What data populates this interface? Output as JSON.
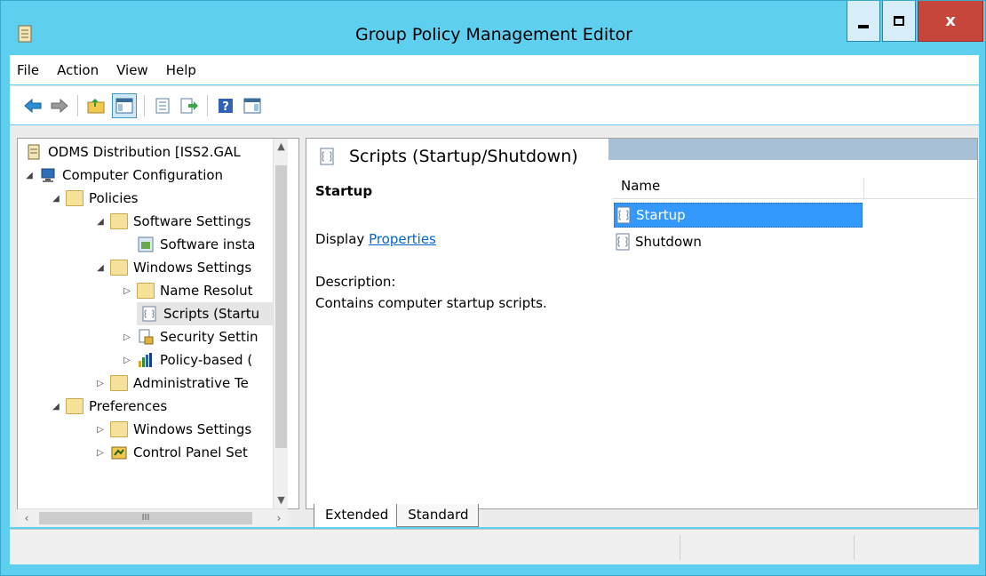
{
  "window": {
    "title": "Group Policy Management Editor",
    "close_label": "x"
  },
  "menu": [
    "File",
    "Action",
    "View",
    "Help"
  ],
  "toolbar": {
    "buttons": [
      "back-icon",
      "forward-icon",
      "up-folder-icon",
      "show-hide-console-tree-icon",
      "properties-icon",
      "export-list-icon",
      "help-icon",
      "show-hide-action-pane-icon"
    ]
  },
  "tree": {
    "items": [
      {
        "label": "ODMS Distribution [ISS2.GAL",
        "level": 0
      },
      {
        "label": "Computer Configuration",
        "level": 1
      },
      {
        "label": "Policies",
        "level": 2
      },
      {
        "label": "Software Settings",
        "level": 3
      },
      {
        "label": "Software insta",
        "level": 4
      },
      {
        "label": "Windows Settings",
        "level": 3
      },
      {
        "label": "Name Resolut",
        "level": 4
      },
      {
        "label": "Scripts (Startu",
        "level": 4
      },
      {
        "label": "Security Settin",
        "level": 4
      },
      {
        "label": "Policy-based (",
        "level": 4
      },
      {
        "label": "Administrative Te",
        "level": 3
      },
      {
        "label": "Preferences",
        "level": 2
      },
      {
        "label": "Windows Settings",
        "level": 3
      },
      {
        "label": "Control Panel Set",
        "level": 3
      }
    ],
    "hscroll_label": "III"
  },
  "detail": {
    "title": "Scripts (Startup/Shutdown)",
    "section_label": "Startup",
    "display_prefix": "Display ",
    "properties_link": "Properties",
    "description_label": "Description:",
    "description_text": "Contains computer startup scripts."
  },
  "list": {
    "column": "Name",
    "items": [
      {
        "label": "Startup",
        "selected": true
      },
      {
        "label": "Shutdown",
        "selected": false
      }
    ]
  },
  "tabs": [
    {
      "label": "Extended",
      "active": true
    },
    {
      "label": "Standard",
      "active": false
    }
  ]
}
